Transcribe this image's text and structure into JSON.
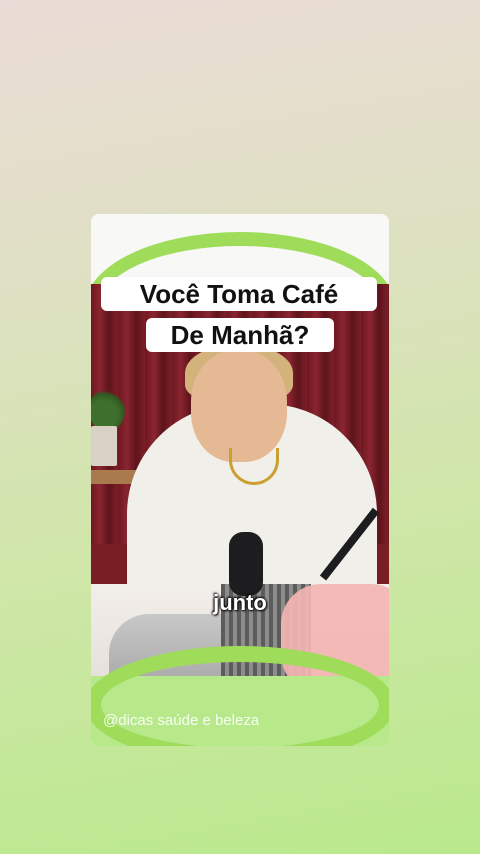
{
  "overlay": {
    "title_line_1": "Você Toma Café",
    "title_line_2": "De Manhã?",
    "caption": "junto",
    "watermark": "@dicas saúde e beleza"
  },
  "colors": {
    "background_top": "#eadbd6",
    "background_bottom": "#b9e98c",
    "ring_green": "#9fdc5a",
    "curtain_red": "#7a1e26"
  }
}
